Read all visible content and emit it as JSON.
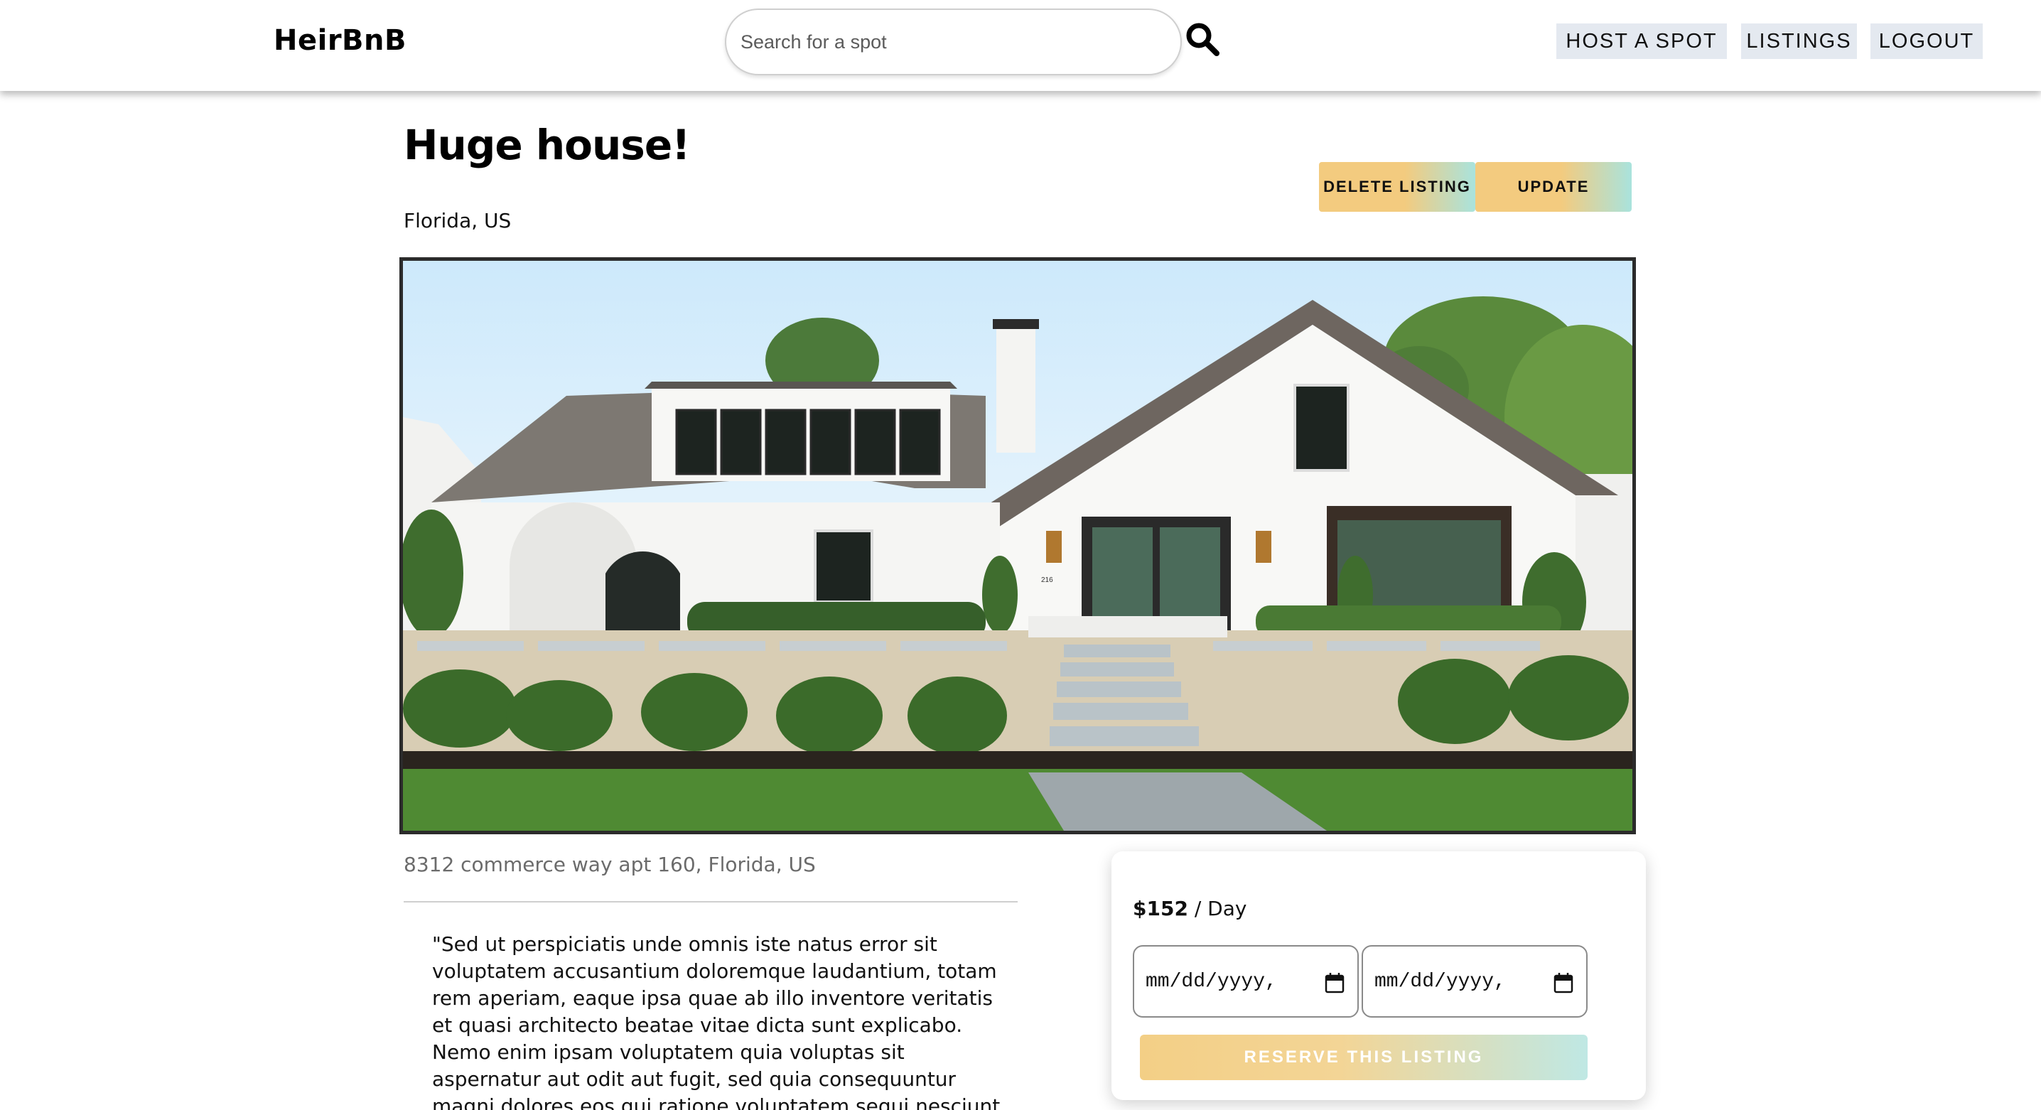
{
  "header": {
    "brand": "HeirBnB",
    "search": {
      "placeholder": "Search for a spot",
      "value": ""
    },
    "nav": {
      "host": "HOST A SPOT",
      "listings": "LISTINGS",
      "logout": "LOGOUT"
    }
  },
  "listing": {
    "title": "Huge house!",
    "location": "Florida, US",
    "actions": {
      "delete": "DELETE LISTING",
      "update": "UPDATE"
    },
    "photo": {
      "house_number": "216"
    },
    "address": "8312 commerce way apt 160, Florida, US",
    "description": "\"Sed ut perspiciatis unde omnis iste natus error sit voluptatem accusantium doloremque laudantium, totam rem aperiam, eaque ipsa quae ab illo inventore veritatis et quasi architecto beatae vitae dicta sunt explicabo. Nemo enim ipsam voluptatem quia voluptas sit aspernatur aut odit aut fugit, sed quia consequuntur magni dolores eos qui ratione voluptatem sequi nesciunt. Neque porro"
  },
  "booking": {
    "price": "$152",
    "unit": " / Day",
    "start_date": "mm/dd/yyyy,",
    "end_date": "mm/dd/yyyy,",
    "reserve": "RESERVE THIS LISTING"
  },
  "colors": {
    "button_gold": "#f3cb7f",
    "button_teal": "#a9e3dd",
    "nav_bg": "#e4e9f0"
  }
}
